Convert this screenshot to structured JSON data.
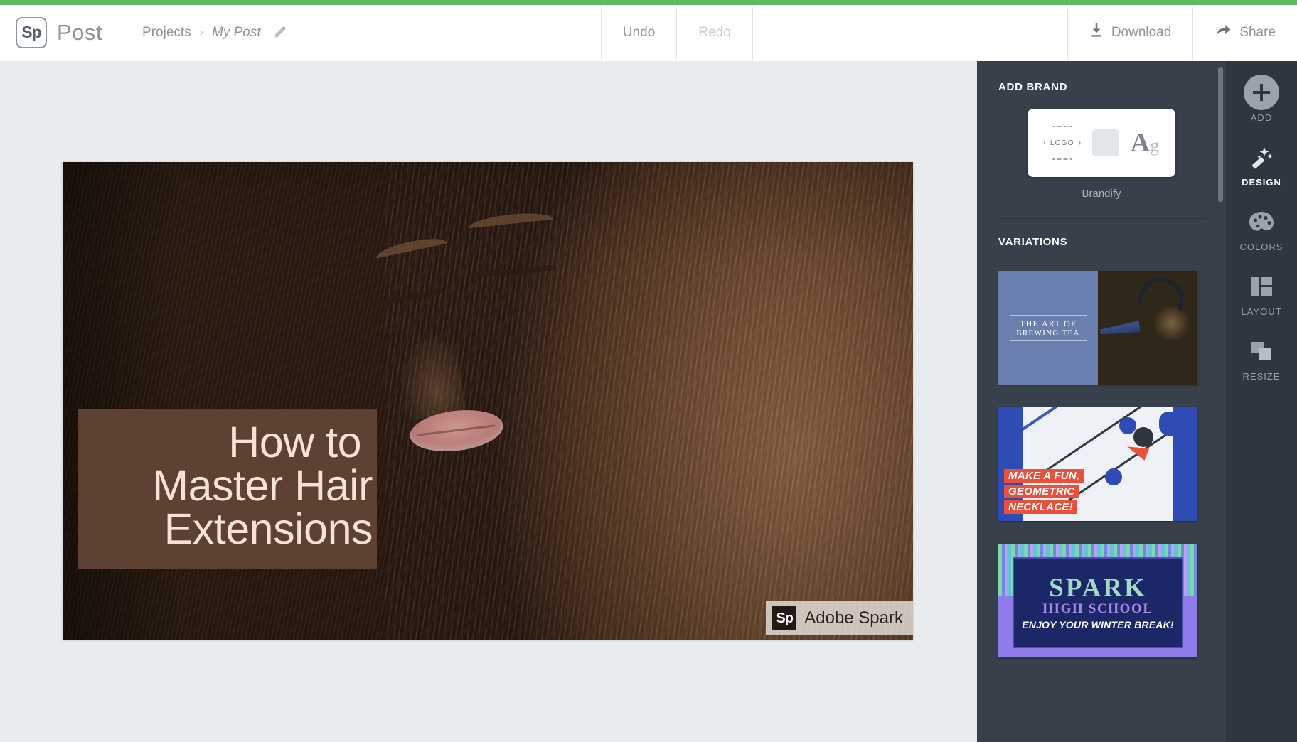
{
  "app": {
    "logo_text": "Sp",
    "name": "Post",
    "accent_color": "#5dbb63",
    "panel_bg": "#38414b",
    "rail_bg": "#2f363f"
  },
  "breadcrumb": {
    "root": "Projects",
    "separator": "›",
    "current": "My Post",
    "edit_icon": "pencil-icon"
  },
  "header": {
    "undo_label": "Undo",
    "redo_label": "Redo",
    "download_label": "Download",
    "share_label": "Share",
    "download_icon": "download-icon",
    "share_icon": "share-arrow-icon"
  },
  "canvas": {
    "headline_lines": [
      "How to",
      "Master Hair",
      "Extensions"
    ],
    "text_box_color": "#5d4234",
    "text_color": "#f6e3d5",
    "watermark": {
      "badge": "Sp",
      "label": "Adobe Spark"
    }
  },
  "side_panel": {
    "add_brand": {
      "title": "ADD BRAND",
      "logo_placeholder": "LOGO",
      "type_sample_big": "A",
      "type_sample_small": "g",
      "caption": "Brandify"
    },
    "variations": {
      "title": "VARIATIONS",
      "items": [
        {
          "name": "art-of-brewing-tea",
          "lines": [
            "THE ART OF",
            "BREWING TEA"
          ],
          "accent_color": "#6a7fae"
        },
        {
          "name": "geometric-necklace",
          "lines": [
            "MAKE A FUN,",
            "GEOMETRIC",
            "NECKLACE!"
          ],
          "accent_color": "#e8513c"
        },
        {
          "name": "spark-high-school",
          "line1": "SPARK",
          "line2": "HIGH SCHOOL",
          "line3": "ENJOY YOUR WINTER BREAK!",
          "accent_color": "#8f7bea"
        }
      ]
    }
  },
  "tool_rail": {
    "items": [
      {
        "label": "ADD",
        "icon": "plus-circle-icon",
        "active": false
      },
      {
        "label": "DESIGN",
        "icon": "magic-wand-icon",
        "active": true
      },
      {
        "label": "COLORS",
        "icon": "palette-icon",
        "active": false
      },
      {
        "label": "LAYOUT",
        "icon": "layout-columns-icon",
        "active": false
      },
      {
        "label": "RESIZE",
        "icon": "resize-frames-icon",
        "active": false
      }
    ]
  }
}
